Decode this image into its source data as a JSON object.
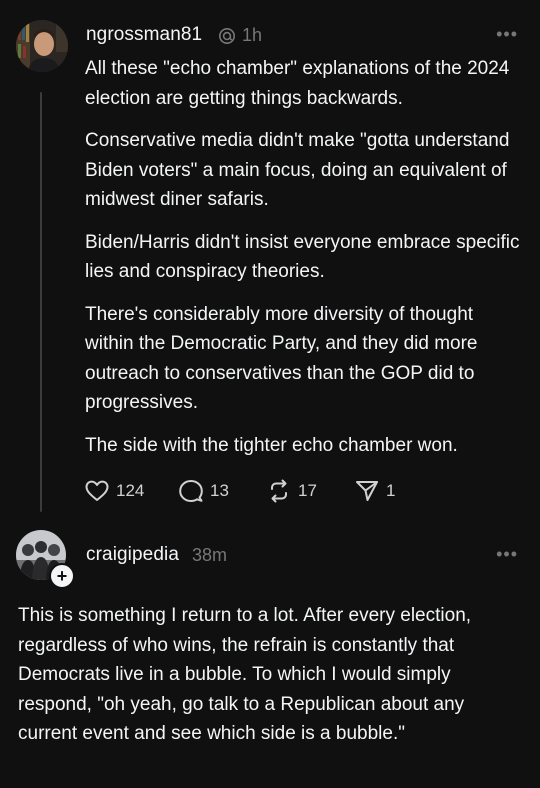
{
  "post1": {
    "username": "ngrossman81",
    "time": "1h",
    "paragraphs": [
      "All these \"echo chamber\" explanations of the 2024 election are getting things backwards.",
      "Conservative media didn't make \"gotta understand Biden voters\" a main focus, doing an equivalent of midwest diner safaris.",
      "Biden/Harris didn't insist everyone embrace specific lies and conspiracy theories.",
      "There's considerably more diversity of thought within the Democratic Party, and they did more outreach to conservatives than the GOP did to progressives.",
      "The side with the tighter echo chamber won."
    ],
    "likes": "124",
    "replies": "13",
    "reposts": "17",
    "shares": "1"
  },
  "post2": {
    "username": "craigipedia",
    "time": "38m",
    "text": "This is something I return to a lot. After every election, regardless of who wins, the refrain is constantly that Democrats live in a bubble. To which I would simply respond, \"oh yeah, go talk to a Republican about any current event and see which side is a bubble.\""
  },
  "icons": {
    "more": "more-horizontal-icon",
    "like": "heart-icon",
    "reply": "comment-icon",
    "repost": "repost-icon",
    "share": "send-icon",
    "verified_ring": "threads-ring-icon",
    "follow": "plus-icon"
  },
  "colors": {
    "background": "#101010",
    "text": "#f3f5f7",
    "muted": "#777777",
    "thread_line": "#3b3b3b"
  }
}
